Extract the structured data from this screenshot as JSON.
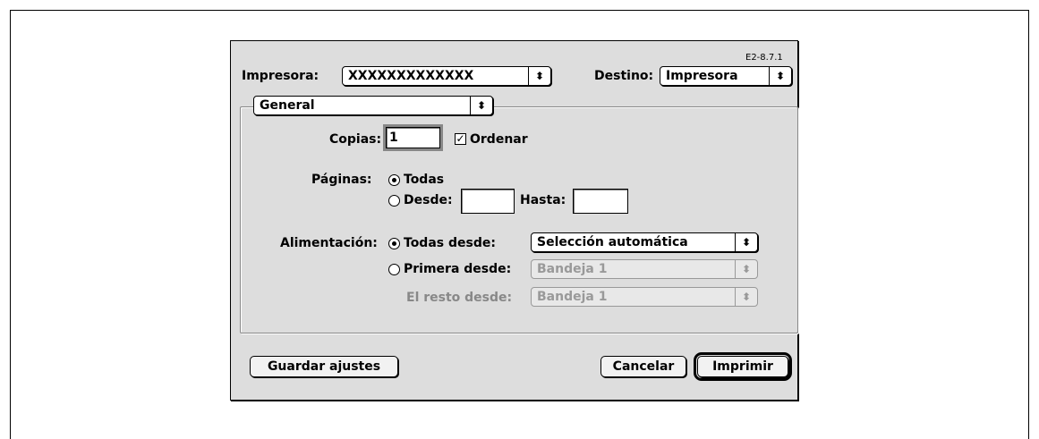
{
  "version_label": "E2-8.7.1",
  "printer": {
    "label": "Impresora:",
    "value": "XXXXXXXXXXXXX",
    "arrows": "⬍"
  },
  "destination": {
    "label": "Destino:",
    "value": "Impresora",
    "arrows": "⬍"
  },
  "panel": {
    "value": "General",
    "arrows": "⬍"
  },
  "copies": {
    "label": "Copias:",
    "value": "1",
    "collate_label": "Ordenar",
    "collate_checked": true,
    "check_glyph": "✓"
  },
  "pages": {
    "label": "Páginas:",
    "all_label": "Todas",
    "from_label": "Desde:",
    "to_label": "Hasta:",
    "from_value": "",
    "to_value": ""
  },
  "paper_source": {
    "label": "Alimentación:",
    "all_from_label": "Todas desde:",
    "all_from_value": "Selección automática",
    "first_from_label": "Primera desde:",
    "first_from_value": "Bandeja 1",
    "rest_from_label": "El resto desde:",
    "rest_from_value": "Bandeja 1",
    "arrows": "⬍"
  },
  "buttons": {
    "save_settings": "Guardar ajustes",
    "cancel": "Cancelar",
    "print": "Imprimir"
  }
}
